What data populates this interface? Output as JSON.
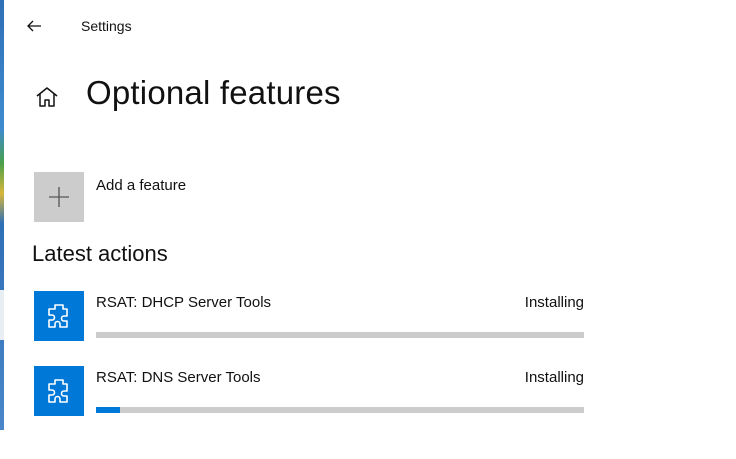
{
  "window": {
    "title": "Settings"
  },
  "page": {
    "title": "Optional features"
  },
  "add_feature": {
    "label": "Add a feature"
  },
  "latest_actions": {
    "title": "Latest actions",
    "items": [
      {
        "name": "RSAT: DHCP Server Tools",
        "status": "Installing",
        "progress": 0.0
      },
      {
        "name": "RSAT: DNS Server Tools",
        "status": "Installing",
        "progress": 0.05
      }
    ]
  },
  "icons": {
    "back": "arrow-left-icon",
    "home": "home-icon",
    "add": "plus-icon",
    "feature": "puzzle-piece-icon"
  },
  "colors": {
    "accent": "#0078d7",
    "tile_gray": "#cccccc",
    "progress_track": "#cccccc"
  }
}
